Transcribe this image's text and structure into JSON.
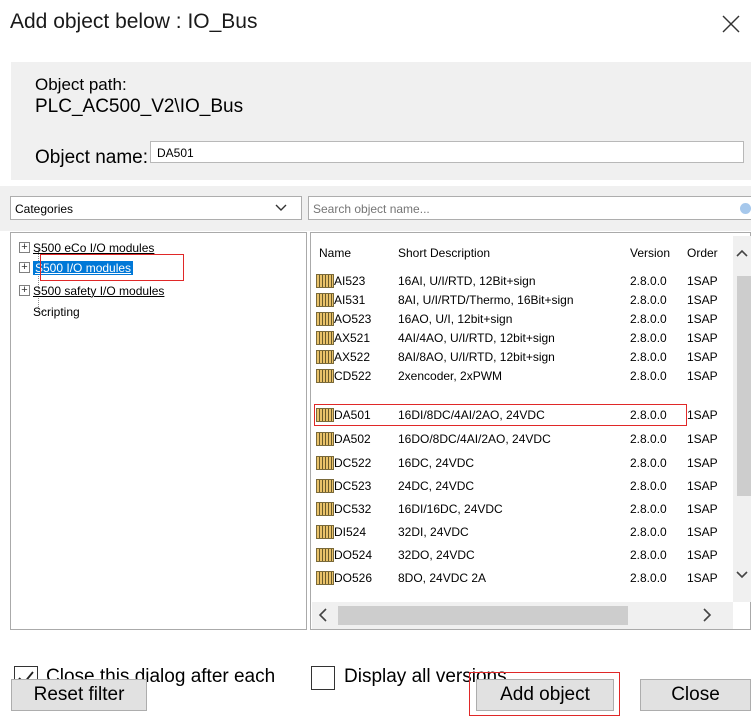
{
  "dialog": {
    "title": "Add object below : IO_Bus"
  },
  "object": {
    "path_label": "Object path:",
    "path_value": "PLC_AC500_V2\\IO_Bus",
    "name_label": "Object name:",
    "name_value": "DA501"
  },
  "filters": {
    "category_selected": "Categories",
    "search_placeholder": "Search object name..."
  },
  "tree": {
    "items": [
      {
        "label": "S500 eCo I/O modules",
        "expandable": true
      },
      {
        "label": "S500 I/O modules",
        "expandable": true,
        "selected": true
      },
      {
        "label": "S500 safety I/O modules",
        "expandable": true
      },
      {
        "label": "Scripting",
        "expandable": false
      }
    ]
  },
  "list": {
    "columns": [
      "Name",
      "Short Description",
      "Version",
      "Order"
    ],
    "rows": [
      {
        "name": "AI523",
        "desc": "16AI, U/I/RTD, 12Bit+sign",
        "version": "2.8.0.0",
        "order": "1SAP"
      },
      {
        "name": "AI531",
        "desc": "8AI, U/I/RTD/Thermo, 16Bit+sign",
        "version": "2.8.0.0",
        "order": "1SAP"
      },
      {
        "name": "AO523",
        "desc": "16AO, U/I, 12bit+sign",
        "version": "2.8.0.0",
        "order": "1SAP"
      },
      {
        "name": "AX521",
        "desc": "4AI/4AO, U/I/RTD, 12bit+sign",
        "version": "2.8.0.0",
        "order": "1SAP"
      },
      {
        "name": "AX522",
        "desc": "8AI/8AO, U/I/RTD, 12bit+sign",
        "version": "2.8.0.0",
        "order": "1SAP"
      },
      {
        "name": "CD522",
        "desc": "2xencoder, 2xPWM",
        "version": "2.8.0.0",
        "order": "1SAP"
      },
      {
        "name": "DA501",
        "desc": "16DI/8DC/4AI/2AO, 24VDC",
        "version": "2.8.0.0",
        "order": "1SAP"
      },
      {
        "name": "DA502",
        "desc": "16DO/8DC/4AI/2AO, 24VDC",
        "version": "2.8.0.0",
        "order": "1SAP"
      },
      {
        "name": "DC522",
        "desc": "16DC, 24VDC",
        "version": "2.8.0.0",
        "order": "1SAP"
      },
      {
        "name": "DC523",
        "desc": "24DC, 24VDC",
        "version": "2.8.0.0",
        "order": "1SAP"
      },
      {
        "name": "DC532",
        "desc": "16DI/16DC, 24VDC",
        "version": "2.8.0.0",
        "order": "1SAP"
      },
      {
        "name": "DI524",
        "desc": "32DI, 24VDC",
        "version": "2.8.0.0",
        "order": "1SAP"
      },
      {
        "name": "DO524",
        "desc": "32DO, 24VDC",
        "version": "2.8.0.0",
        "order": "1SAP"
      },
      {
        "name": "DO526",
        "desc": "8DO, 24VDC 2A",
        "version": "2.8.0.0",
        "order": "1SAP"
      }
    ]
  },
  "options": {
    "close_after_add_label": "Close this dialog after each",
    "close_after_add_checked": true,
    "display_all_versions_label": "Display all versions",
    "display_all_versions_checked": false
  },
  "buttons": {
    "reset_filter": "Reset filter",
    "add_object": "Add object",
    "close": "Close"
  },
  "colors": {
    "selection": "#0078d7",
    "highlight_box": "#e02828",
    "panel_bg": "#f0f0f0"
  }
}
